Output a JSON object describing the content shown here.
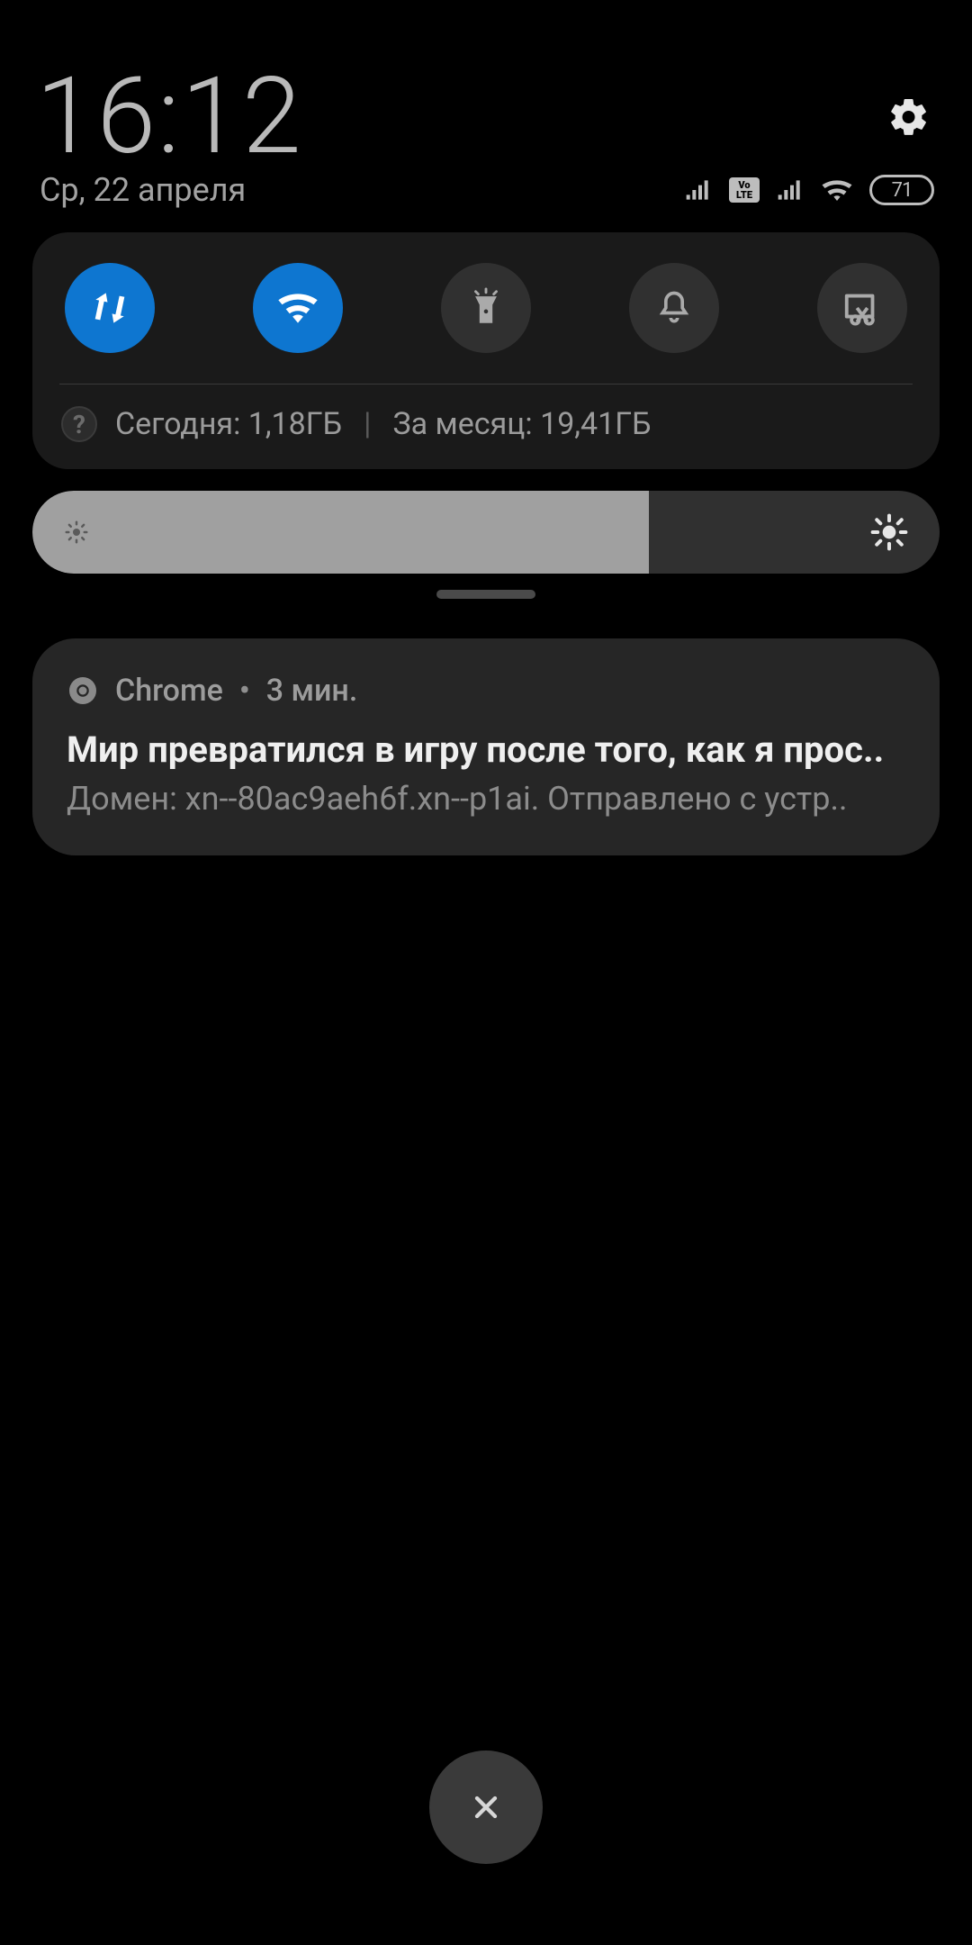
{
  "clock": {
    "time": "16:12",
    "date": "Ср, 22 апреля"
  },
  "status": {
    "battery": "71"
  },
  "quick_settings": {
    "data": {
      "on": true,
      "name": "mobile-data"
    },
    "wifi": {
      "on": true,
      "name": "wifi"
    },
    "torch": {
      "on": false,
      "name": "flashlight"
    },
    "dnd": {
      "on": false,
      "name": "dnd"
    },
    "screenshot": {
      "on": false,
      "name": "screenshot"
    }
  },
  "data_usage": {
    "today_label": "Сегодня: 1,18ГБ",
    "month_label": "За месяц: 19,41ГБ"
  },
  "brightness": {
    "percent": 68
  },
  "notification": {
    "app": "Chrome",
    "time": "3 мин.",
    "title": "Мир превратился в игру после того, как я прос..",
    "subtitle": "Домен: xn--80ac9aeh6f.xn--p1ai. Отправлено с устр.."
  }
}
